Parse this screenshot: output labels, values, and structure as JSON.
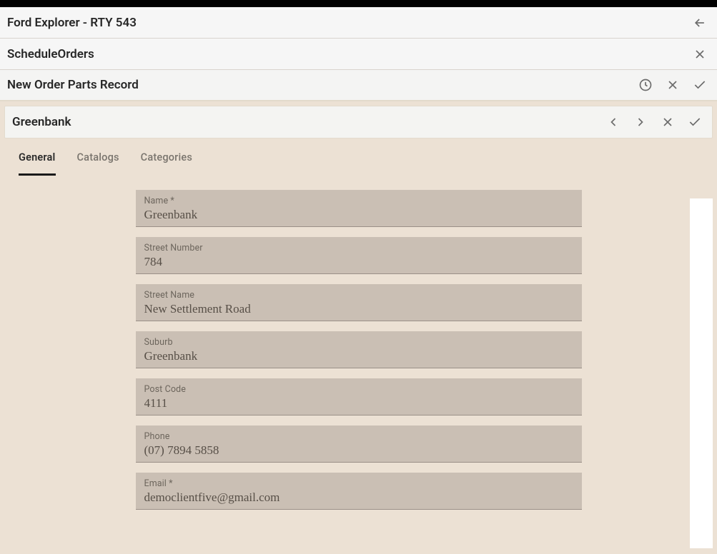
{
  "header1": {
    "title": "Ford Explorer - RTY 543"
  },
  "header2": {
    "title": "ScheduleOrders"
  },
  "header3": {
    "title": "New Order Parts Record"
  },
  "header4": {
    "title": "Greenbank"
  },
  "tabs": {
    "general": "General",
    "catalogs": "Catalogs",
    "categories": "Categories"
  },
  "form": {
    "name": {
      "label": "Name *",
      "value": "Greenbank"
    },
    "streetNumber": {
      "label": "Street Number",
      "value": "784"
    },
    "streetName": {
      "label": "Street Name",
      "value": "New Settlement Road"
    },
    "suburb": {
      "label": "Suburb",
      "value": "Greenbank"
    },
    "postCode": {
      "label": "Post Code",
      "value": "4111"
    },
    "phone": {
      "label": "Phone",
      "value": "(07) 7894 5858"
    },
    "email": {
      "label": "Email *",
      "value": "democlientfive@gmail.com"
    }
  }
}
